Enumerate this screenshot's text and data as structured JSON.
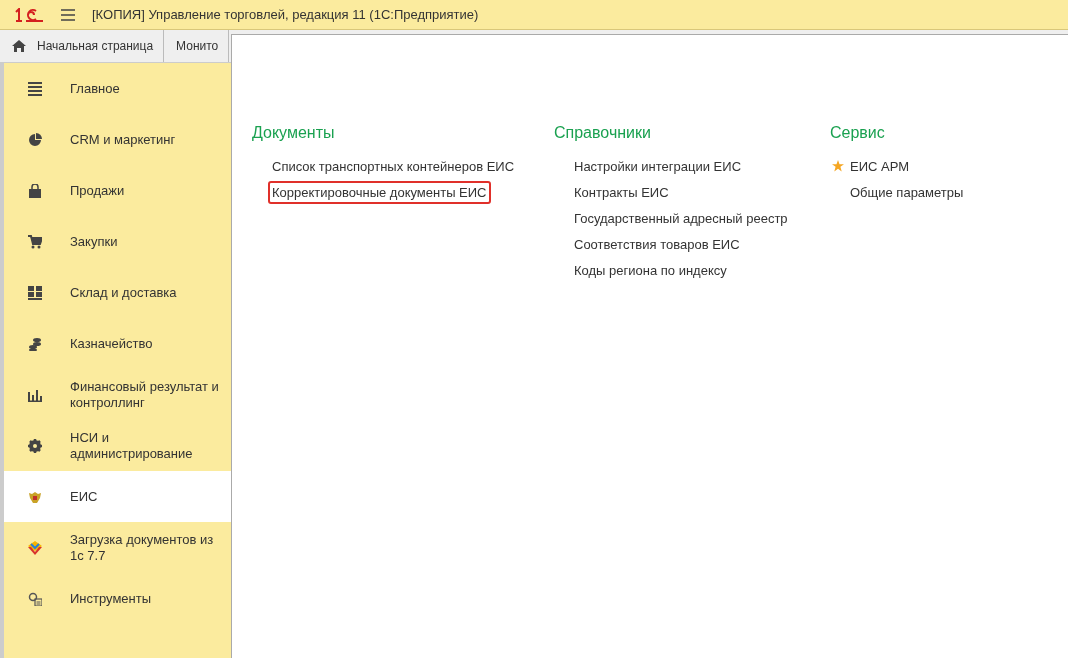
{
  "window": {
    "title": "[КОПИЯ] Управление торговлей, редакция 11  (1С:Предприятие)"
  },
  "tabs": [
    {
      "label": "Начальная страница",
      "kind": "home",
      "selected": false
    },
    {
      "label": "Монито",
      "kind": "plain",
      "selected": false
    }
  ],
  "sidebar": {
    "items": [
      {
        "label": "Главное",
        "selected": false
      },
      {
        "label": "CRM и маркетинг",
        "selected": false
      },
      {
        "label": "Продажи",
        "selected": false
      },
      {
        "label": "Закупки",
        "selected": false
      },
      {
        "label": "Склад и доставка",
        "selected": false
      },
      {
        "label": "Казначейство",
        "selected": false
      },
      {
        "label": "Финансовый результат и контроллинг",
        "selected": false
      },
      {
        "label": "НСИ и администрирование",
        "selected": false
      },
      {
        "label": "ЕИС",
        "selected": true
      },
      {
        "label": "Загрузка документов из 1с 7.7",
        "selected": false
      },
      {
        "label": "Инструменты",
        "selected": false
      }
    ]
  },
  "panel": {
    "sections": [
      {
        "title": "Документы",
        "links": [
          {
            "label": "Список транспортных контейнеров ЕИС",
            "starred": false,
            "highlighted": false
          },
          {
            "label": "Корректировочные документы ЕИС",
            "starred": false,
            "highlighted": true
          }
        ]
      },
      {
        "title": "Справочники",
        "links": [
          {
            "label": "Настройки интеграции ЕИС",
            "starred": false,
            "highlighted": false
          },
          {
            "label": "Контракты ЕИС",
            "starred": false,
            "highlighted": false
          },
          {
            "label": "Государственный адресный реестр",
            "starred": false,
            "highlighted": false
          },
          {
            "label": "Соответствия товаров ЕИС",
            "starred": false,
            "highlighted": false
          },
          {
            "label": "Коды региона по индексу",
            "starred": false,
            "highlighted": false
          }
        ]
      },
      {
        "title": "Сервис",
        "links": [
          {
            "label": "ЕИС АРМ",
            "starred": true,
            "highlighted": false
          },
          {
            "label": "Общие параметры",
            "starred": false,
            "highlighted": false
          }
        ]
      }
    ]
  }
}
